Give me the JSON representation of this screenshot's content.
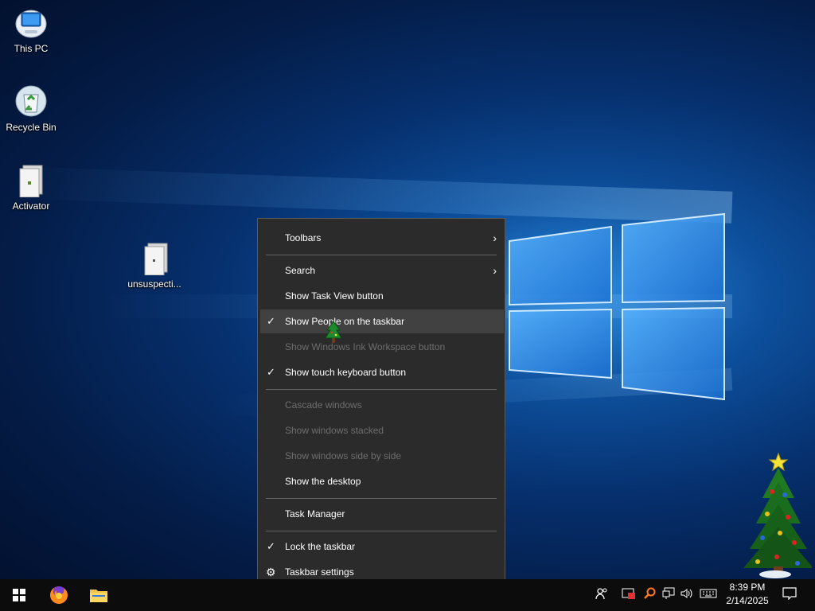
{
  "desktop": {
    "icons": [
      {
        "label": "This PC",
        "icon": "computer-icon"
      },
      {
        "label": "Recycle Bin",
        "icon": "recycle-bin-icon"
      },
      {
        "label": "Activator",
        "icon": "file-icon"
      },
      {
        "label": "unsuspecti...",
        "icon": "file-icon"
      }
    ]
  },
  "context_menu": {
    "items": [
      {
        "label": "Toolbars",
        "state": "enabled",
        "submenu": true
      },
      {
        "label": "Search",
        "state": "enabled",
        "submenu": true
      },
      {
        "label": "Show Task View button",
        "state": "enabled"
      },
      {
        "label": "Show People on the taskbar",
        "state": "enabled",
        "checked": true,
        "highlighted": true
      },
      {
        "label": "Show Windows Ink Workspace button",
        "state": "disabled"
      },
      {
        "label": "Show touch keyboard button",
        "state": "enabled",
        "checked": true
      },
      {
        "label": "Cascade windows",
        "state": "disabled"
      },
      {
        "label": "Show windows stacked",
        "state": "disabled"
      },
      {
        "label": "Show windows side by side",
        "state": "disabled"
      },
      {
        "label": "Show the desktop",
        "state": "enabled"
      },
      {
        "label": "Task Manager",
        "state": "enabled"
      },
      {
        "label": "Lock the taskbar",
        "state": "enabled",
        "checked": true
      },
      {
        "label": "Taskbar settings",
        "state": "enabled",
        "icon": "gear-icon"
      }
    ]
  },
  "taskbar": {
    "pinned": [
      {
        "icon": "start-icon"
      },
      {
        "icon": "firefox-icon"
      },
      {
        "icon": "file-explorer-icon"
      }
    ],
    "tray_icons": [
      "people-icon",
      "security-icon",
      "search-tool-icon",
      "network-icon",
      "volume-icon",
      "keyboard-icon"
    ],
    "clock": {
      "time": "8:39 PM",
      "date": "2/14/2025"
    },
    "notifications_icon": "action-center-icon"
  },
  "colors": {
    "menu_bg": "#2b2b2b",
    "menu_hover": "#414141",
    "menu_disabled_text": "#6d6d6d",
    "taskbar_bg": "#0c0c0c",
    "desktop_accent": "#1e7ad6"
  }
}
